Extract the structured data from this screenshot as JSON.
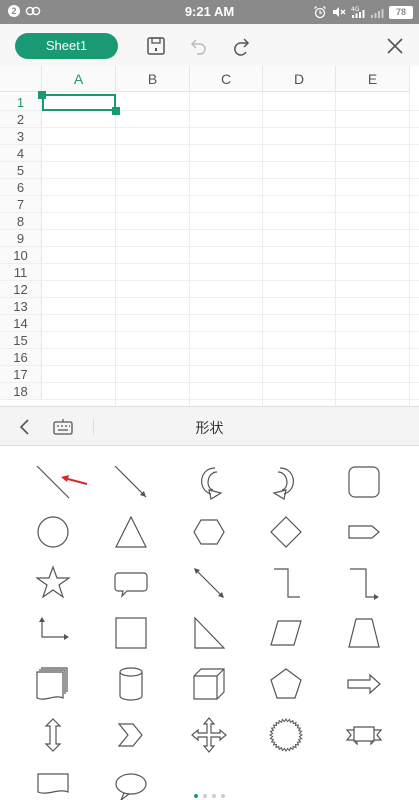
{
  "status_bar": {
    "notification_count": "2",
    "time": "9:21 AM",
    "network_label": "4G",
    "battery": "78"
  },
  "toolbar": {
    "sheet_name": "Sheet1"
  },
  "grid": {
    "columns": [
      "A",
      "B",
      "C",
      "D",
      "E"
    ],
    "rows": [
      "1",
      "2",
      "3",
      "4",
      "5",
      "6",
      "7",
      "8",
      "9",
      "10",
      "11",
      "12",
      "13",
      "14",
      "15",
      "16",
      "17",
      "18"
    ],
    "selected_cell": "A1"
  },
  "panel": {
    "title": "形状"
  },
  "shapes": [
    "line",
    "arrow-line",
    "curved-arrow-left",
    "curved-arrow-right",
    "rounded-rectangle",
    "oval",
    "triangle",
    "hexagon",
    "diamond",
    "pentagon-arrow",
    "star",
    "speech-bubble",
    "double-arrow-line",
    "elbow-connector",
    "elbow-arrow-connector",
    "elbow-double-arrow-connector",
    "rectangle",
    "right-triangle",
    "parallelogram",
    "trapezoid",
    "multi-document",
    "cylinder",
    "cube",
    "pentagon",
    "right-arrow",
    "up-down-arrow",
    "chevron",
    "quad-arrow",
    "seal",
    "ribbon",
    "document",
    "ellipse-callout"
  ],
  "pager": {
    "pages": 4,
    "current": 1
  },
  "colors": {
    "accent": "#1a9a74",
    "annotation_arrow": "#d42a2a"
  }
}
